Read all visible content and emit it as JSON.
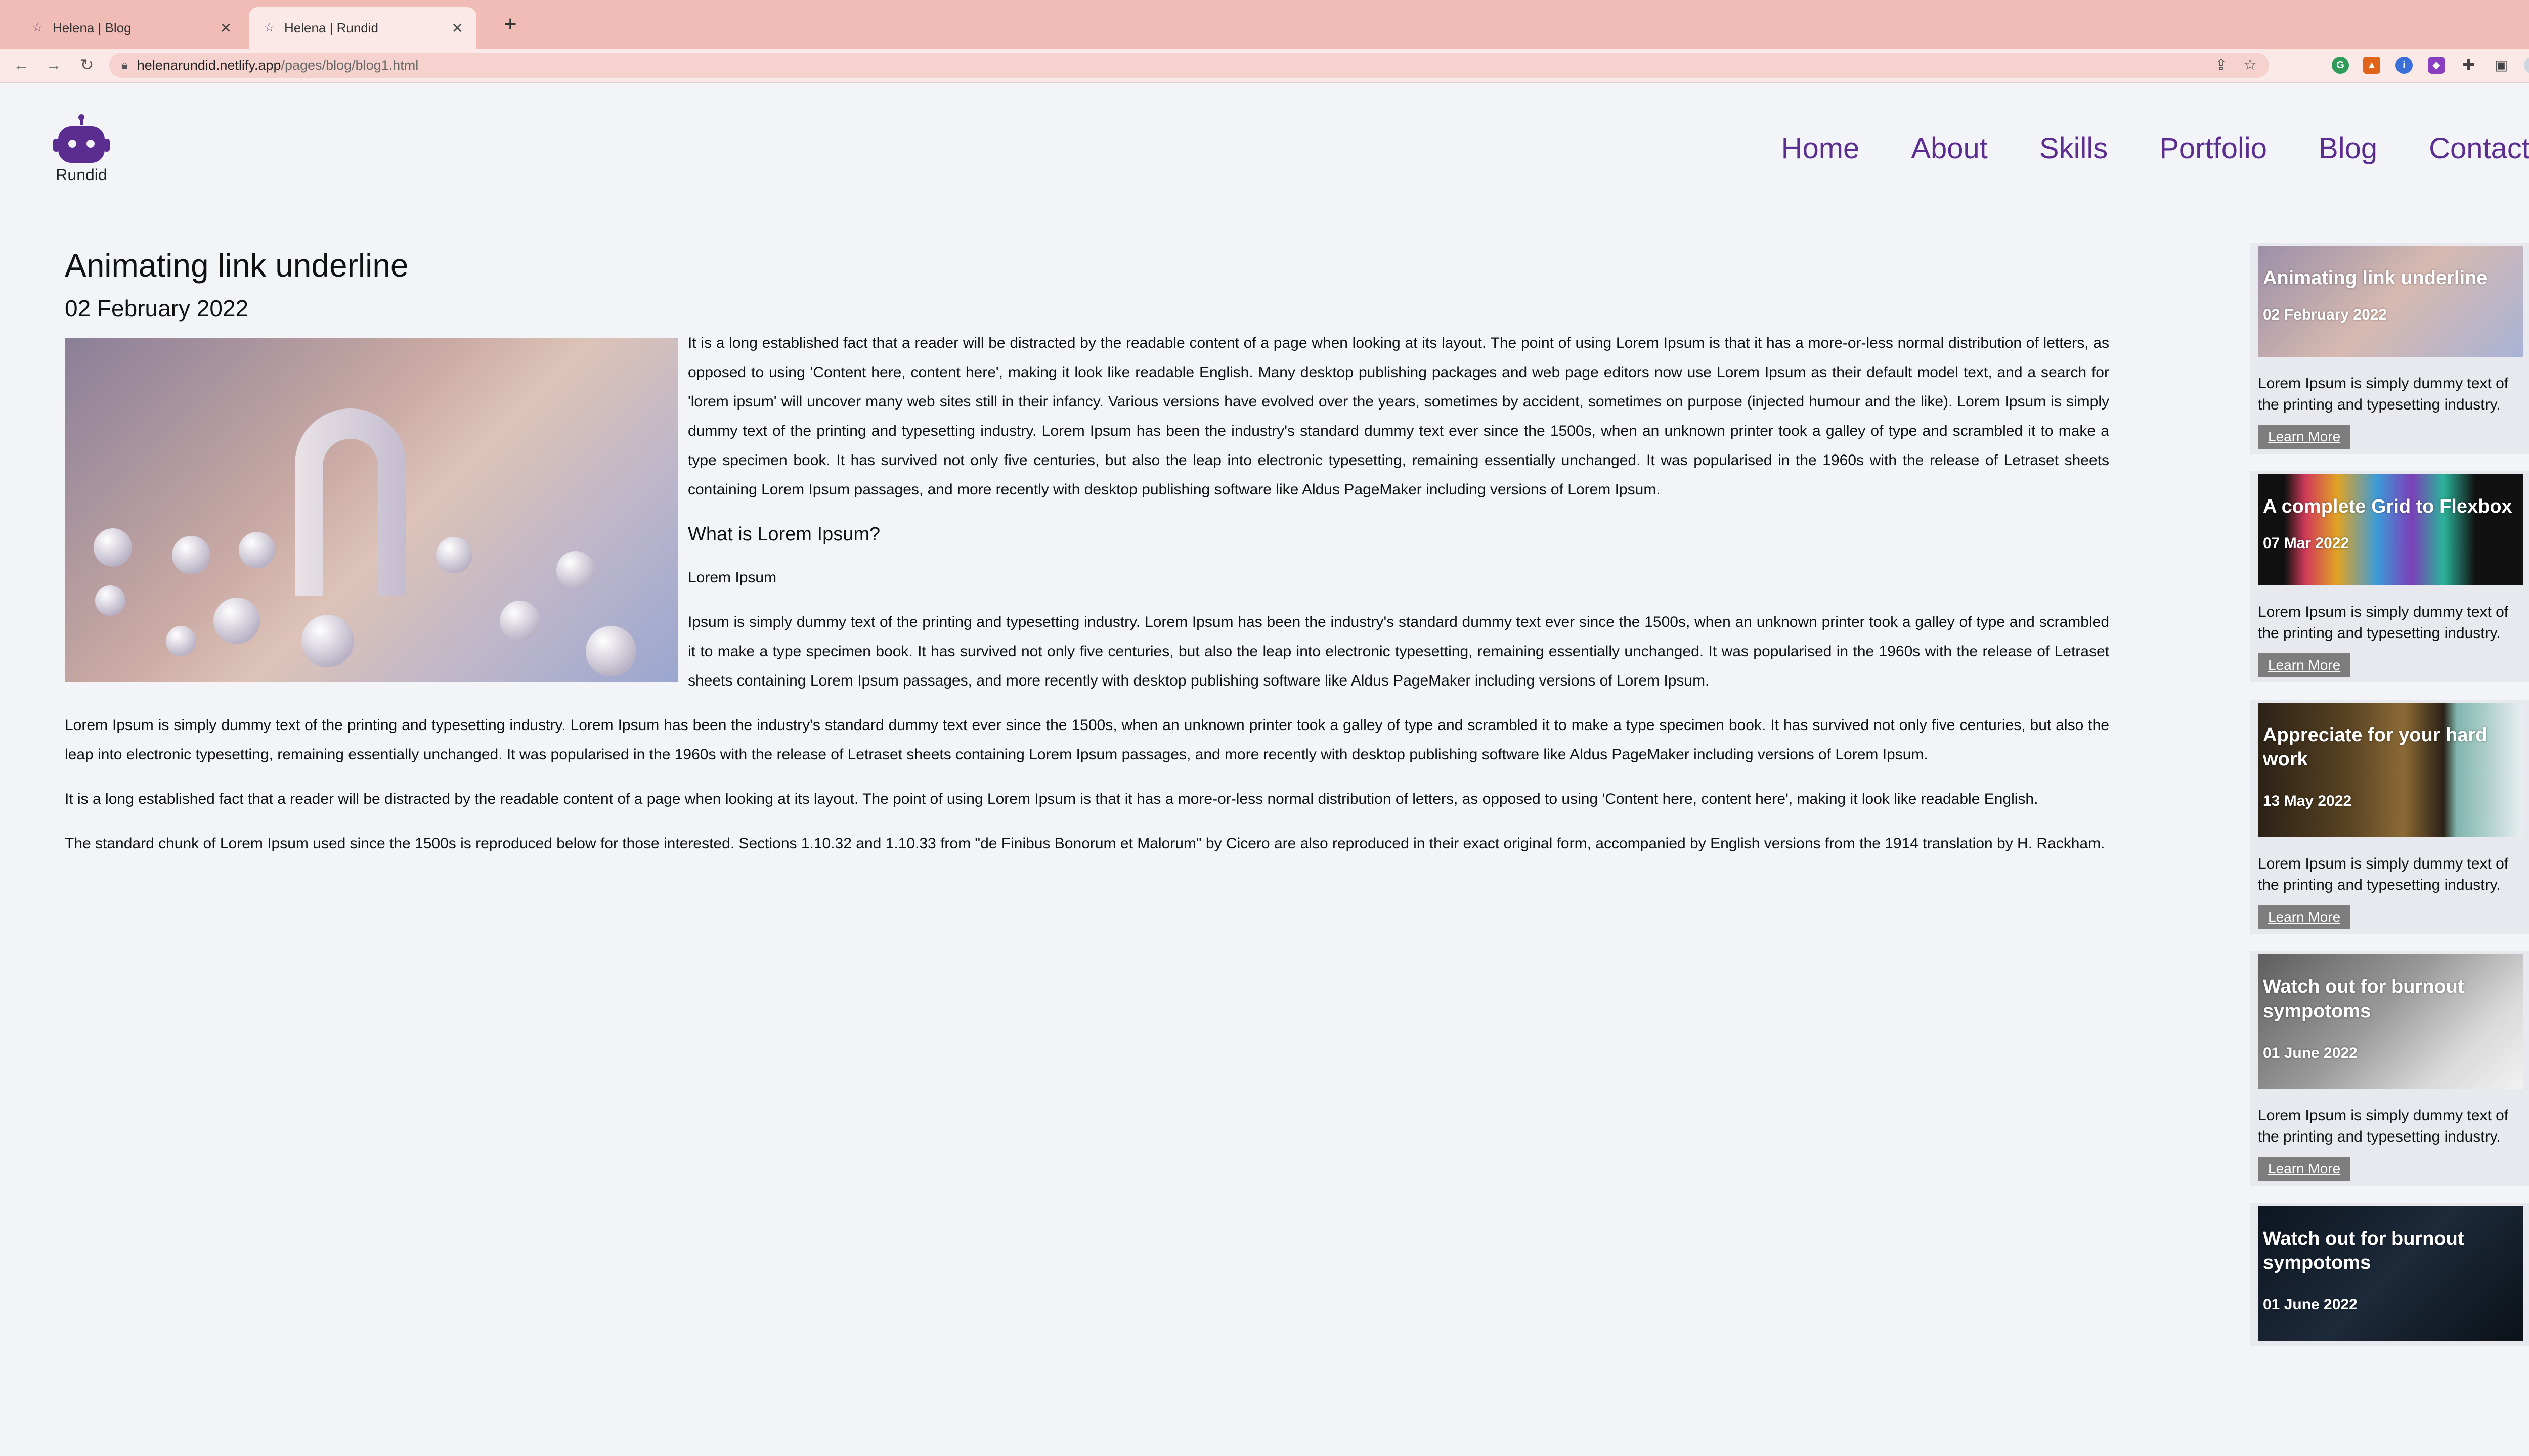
{
  "browser": {
    "tabs": [
      {
        "title": "Helena | Blog",
        "active": false
      },
      {
        "title": "Helena | Rundid",
        "active": true
      }
    ],
    "url_host": "helenarundid.netlify.app",
    "url_path": "/pages/blog/blog1.html"
  },
  "site": {
    "logo_text": "Rundid",
    "nav": [
      "Home",
      "About",
      "Skills",
      "Portfolio",
      "Blog",
      "Contact"
    ],
    "accent_color": "#5b2d90"
  },
  "article": {
    "title": "Animating link underline",
    "date": "02 February 2022",
    "intro": "It is a long established fact that a reader will be distracted by the readable content of a page when looking at its layout. The point of using Lorem Ipsum is that it has a more-or-less normal distribution of letters, as opposed to using 'Content here, content here', making it look like readable English. Many desktop publishing packages and web page editors now use Lorem Ipsum as their default model text, and a search for 'lorem ipsum' will uncover many web sites still in their infancy. Various versions have evolved over the years, sometimes by accident, sometimes on purpose (injected humour and the like). Lorem Ipsum is simply dummy text of the printing and typesetting industry. Lorem Ipsum has been the industry's standard dummy text ever since the 1500s, when an unknown printer took a galley of type and scrambled it to make a type specimen book. It has survived not only five centuries, but also the leap into electronic typesetting, remaining essentially unchanged. It was popularised in the 1960s with the release of Letraset sheets containing Lorem Ipsum passages, and more recently with desktop publishing software like Aldus PageMaker including versions of Lorem Ipsum.",
    "subheading": "What is Lorem Ipsum?",
    "small_heading": "Lorem Ipsum",
    "p2": "Ipsum is simply dummy text of the printing and typesetting industry. Lorem Ipsum has been the industry's standard dummy text ever since the 1500s, when an unknown printer took a galley of type and scrambled it to make a type specimen book. It has survived not only five centuries, but also the leap into electronic typesetting, remaining essentially unchanged. It was popularised in the 1960s with the release of Letraset sheets containing Lorem Ipsum passages, and more recently with desktop publishing software like Aldus PageMaker including versions of Lorem Ipsum.",
    "p3": "Lorem Ipsum is simply dummy text of the printing and typesetting industry. Lorem Ipsum has been the industry's standard dummy text ever since the 1500s, when an unknown printer took a galley of type and scrambled it to make a type specimen book. It has survived not only five centuries, but also the leap into electronic typesetting, remaining essentially unchanged. It was popularised in the 1960s with the release of Letraset sheets containing Lorem Ipsum passages, and more recently with desktop publishing software like Aldus PageMaker including versions of Lorem Ipsum.",
    "p4": "It is a long established fact that a reader will be distracted by the readable content of a page when looking at its layout. The point of using Lorem Ipsum is that it has a more-or-less normal distribution of letters, as opposed to using 'Content here, content here', making it look like readable English.",
    "p5": "The standard chunk of Lorem Ipsum used since the 1500s is reproduced below for those interested. Sections 1.10.32 and 1.10.33 from \"de Finibus Bonorum et Malorum\" by Cicero are also reproduced in their exact original form, accompanied by English versions from the 1914 translation by H. Rackham."
  },
  "sidebar": {
    "cards": [
      {
        "title": "Animating link underline",
        "date": "02 February 2022",
        "text": "Lorem Ipsum is simply dummy text of the printing and typesetting industry.",
        "button": "Learn More"
      },
      {
        "title": "A complete Grid to Flexbox",
        "date": "07 Mar 2022",
        "text": "Lorem Ipsum is simply dummy text of the printing and typesetting industry.",
        "button": "Learn More"
      },
      {
        "title": "Appreciate for your hard work",
        "date": "13 May 2022",
        "text": "Lorem Ipsum is simply dummy text of the printing and typesetting industry.",
        "button": "Learn More"
      },
      {
        "title": "Watch out for burnout sympotoms",
        "date": "01 June 2022",
        "text": "Lorem Ipsum is simply dummy text of the printing and typesetting industry.",
        "button": "Learn More"
      },
      {
        "title": "Watch out for burnout sympotoms",
        "date": "01 June 2022"
      }
    ]
  }
}
